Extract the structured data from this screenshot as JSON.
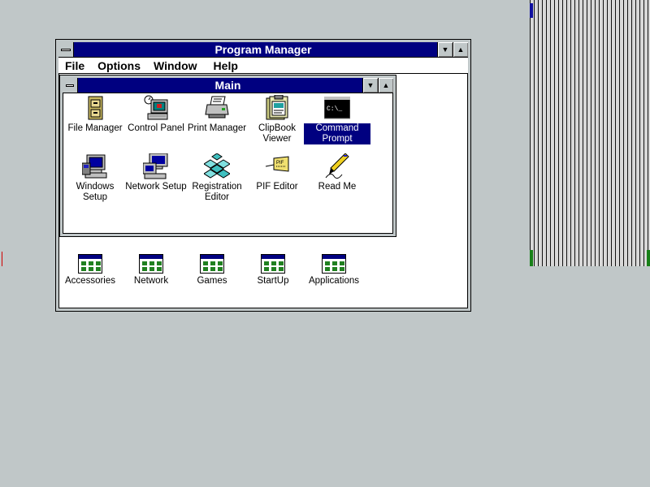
{
  "program_manager": {
    "title": "Program Manager",
    "menu": [
      "File",
      "Options",
      "Window",
      "Help"
    ]
  },
  "main_group": {
    "title": "Main",
    "icons": [
      {
        "label": "File Manager",
        "icon": "file-cabinet-icon"
      },
      {
        "label": "Control Panel",
        "icon": "control-panel-icon"
      },
      {
        "label": "Print Manager",
        "icon": "printer-icon"
      },
      {
        "label": "ClipBook Viewer",
        "icon": "clipbook-icon"
      },
      {
        "label": "Command Prompt",
        "icon": "command-prompt-icon",
        "selected": true
      },
      {
        "label": "Windows Setup",
        "icon": "windows-setup-icon"
      },
      {
        "label": "Network Setup",
        "icon": "network-setup-icon"
      },
      {
        "label": "Registration Editor",
        "icon": "registry-editor-icon"
      },
      {
        "label": "PIF Editor",
        "icon": "pif-editor-icon"
      },
      {
        "label": "Read Me",
        "icon": "read-me-icon"
      }
    ]
  },
  "group_icons": [
    {
      "label": "Accessories"
    },
    {
      "label": "Network"
    },
    {
      "label": "Games"
    },
    {
      "label": "StartUp"
    },
    {
      "label": "Applications"
    }
  ],
  "colors": {
    "desktop": "#c0c7c8",
    "titlebar_active": "#000080",
    "selection": "#000080"
  }
}
